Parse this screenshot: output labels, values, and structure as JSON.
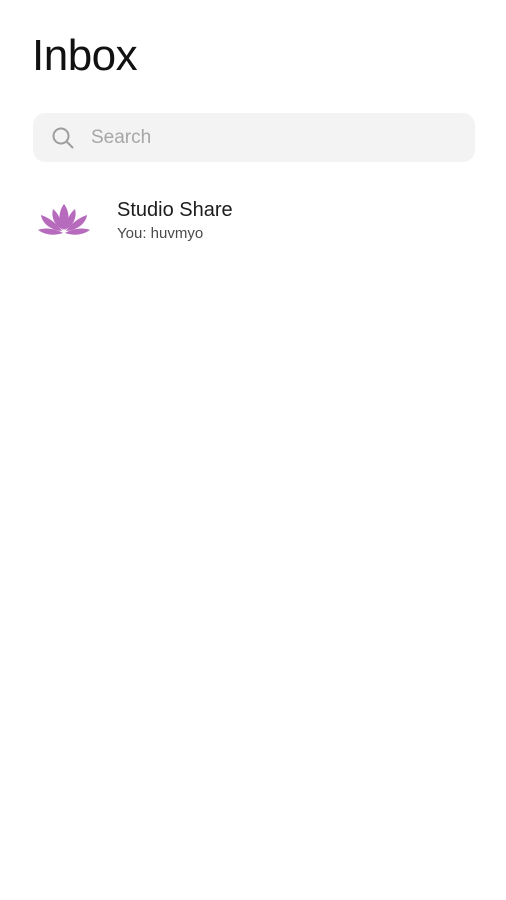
{
  "header": {
    "title": "Inbox"
  },
  "search": {
    "placeholder": "Search",
    "value": "",
    "icon": "search-icon"
  },
  "conversations": [
    {
      "name": "Studio Share",
      "preview": "You: huvmyo",
      "avatar_icon": "lotus-icon",
      "avatar_color": "#b76bbd"
    }
  ],
  "colors": {
    "background": "#ffffff",
    "search_background": "#f3f3f3",
    "placeholder": "#a6a6a6",
    "accent_lotus": "#b76bbd"
  }
}
